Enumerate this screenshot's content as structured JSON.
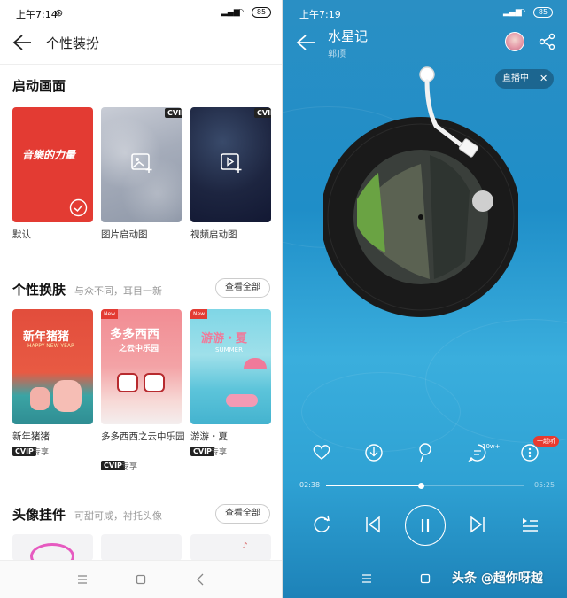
{
  "left": {
    "status": {
      "time": "上午7:14",
      "battery": "85"
    },
    "header": {
      "title": "个性装扮"
    },
    "launch": {
      "title": "启动画面",
      "default_text": "音樂的力量",
      "items": [
        {
          "label": "默认"
        },
        {
          "label": "图片启动图"
        },
        {
          "label": "视频启动图"
        }
      ],
      "badge": "CVIP"
    },
    "skins": {
      "title": "个性换肤",
      "subtitle": "与众不同，耳目一新",
      "view_all": "查看全部",
      "items": [
        {
          "label": "新年猪猪",
          "art_title": "新年猪猪",
          "art_sub": "HAPPY NEW YEAR",
          "tag": "CVIP",
          "exclusive": "专享"
        },
        {
          "label": "多多西西之云中乐园",
          "art_title": "多多西西",
          "art_sub": "之云中乐园",
          "tag": "CVIP",
          "exclusive": "专享",
          "new": "New"
        },
        {
          "label": "游游・夏",
          "art_title": "游游・夏",
          "art_sub": "SUMMER",
          "tag": "CVIP",
          "exclusive": "专享",
          "new": "New"
        }
      ]
    },
    "avatar": {
      "title": "头像挂件",
      "subtitle": "可甜可咸，衬托头像",
      "view_all": "查看全部"
    }
  },
  "right": {
    "status": {
      "time": "上午7:19",
      "battery": "85"
    },
    "song": {
      "title": "水星记",
      "singer": "郭顶"
    },
    "live": "直播中",
    "comment_count": "10w+",
    "together": "一起听",
    "progress": {
      "current": "02:38",
      "total": "05:25",
      "fraction": 0.48
    },
    "watermark": "头条 @超你呀越"
  },
  "colors": {
    "accent_red": "#e33b33",
    "card_blue": "#2a8fc4"
  }
}
